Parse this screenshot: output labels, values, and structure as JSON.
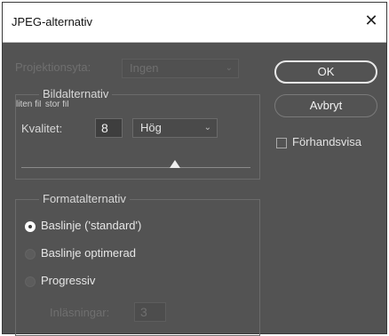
{
  "window": {
    "title": "JPEG-alternativ",
    "close_icon": "close-icon"
  },
  "projection": {
    "label": "Projektionsyta:",
    "value": "Ingen",
    "disabled": true
  },
  "image_options": {
    "legend": "Bildalternativ",
    "quality_label": "Kvalitet:",
    "quality_value": "8",
    "quality_level": "Hög",
    "small_file_label": "liten fil",
    "large_file_label": "stor fil",
    "slider_position": 0.67
  },
  "format_options": {
    "legend": "Formatalternativ",
    "options": [
      {
        "label": "Baslinje ('standard')",
        "checked": true
      },
      {
        "label": "Baslinje optimerad",
        "checked": false
      },
      {
        "label": "Progressiv",
        "checked": false
      }
    ],
    "scans_label": "Inläsningar:",
    "scans_value": "3",
    "scans_disabled": true
  },
  "buttons": {
    "ok_label": "OK",
    "cancel_label": "Avbryt"
  },
  "preview": {
    "label": "Förhandsvisa",
    "checked": false
  },
  "colors": {
    "panel": "#535353",
    "titlebar": "#ffffff"
  }
}
